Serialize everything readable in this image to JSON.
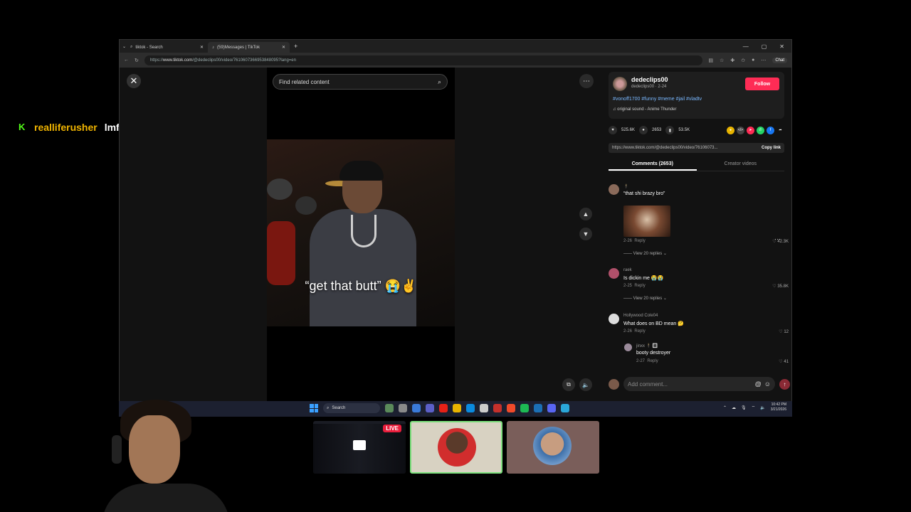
{
  "chat": {
    "user": "realliferusher",
    "message": "lmfao"
  },
  "browser": {
    "tabs": [
      {
        "title": "tiktok - Search"
      },
      {
        "title": "(59)Messages | TikTok"
      }
    ],
    "url_prefix": "https://",
    "url_host": "www.tiktok.com",
    "url_path": "/@dedeclips00/video/7610607366953848095?lang=en",
    "chat_label": "Chat"
  },
  "video": {
    "search_placeholder": "Find related content",
    "caption": "“get that butt” 😭✌️"
  },
  "author": {
    "username": "dedeclips00",
    "subline": "dedeclips00 · 2-24",
    "follow_label": "Follow",
    "hashtags": "#vonoff1700 #funny #meme #jail #vladtv",
    "sound": "original sound - Anime Thunder"
  },
  "stats": {
    "likes": "525.6K",
    "comments": "2653",
    "saves": "53.5K"
  },
  "link": {
    "url": "https://www.tiktok.com/@dedeclips00/video/76106073...",
    "copy_label": "Copy link"
  },
  "panel_tabs": {
    "comments": "Comments (2653)",
    "creator": "Creator videos"
  },
  "comments": [
    {
      "name": "🕴",
      "text": "“that shi brazy bro”",
      "date": "2-26",
      "reply": "Reply",
      "likes": "42.3K",
      "replies": "View 20 replies"
    },
    {
      "name": "raek",
      "text": "Is dickin me 😭😭",
      "date": "2-25",
      "reply": "Reply",
      "likes": "35.8K",
      "replies": "View 20 replies"
    },
    {
      "name": "Hollywood Cole04",
      "text": "What does on BD mean 🤔",
      "date": "2-26",
      "reply": "Reply",
      "likes": "12"
    },
    {
      "name": "jinxx 🕴 🔳",
      "text": "booty destroyer",
      "date": "2-27",
      "reply": "Reply",
      "likes": "41"
    }
  ],
  "add_comment_placeholder": "Add comment...",
  "taskbar": {
    "search": "Search",
    "time": "10:42 PM",
    "date": "3/21/2026"
  },
  "stream": {
    "live_label": "LIVE"
  }
}
